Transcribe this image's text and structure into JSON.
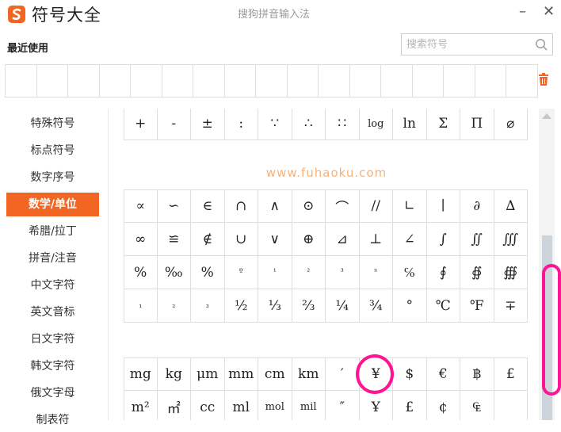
{
  "window": {
    "title": "符号大全",
    "ime_name": "搜狗拼音输入法",
    "minimize": "–",
    "close": "✕"
  },
  "recent": {
    "label": "最近使用",
    "slots": 17
  },
  "search": {
    "placeholder": "搜索符号",
    "value": ""
  },
  "categories": [
    "特殊符号",
    "标点符号",
    "数字序号",
    "数学/单位",
    "希腊/拉丁",
    "拼音/注音",
    "中文字符",
    "英文音标",
    "日文字符",
    "韩文字符",
    "俄文字母",
    "制表符"
  ],
  "active_category": "数学/单位",
  "symbols": {
    "row_partial": [
      "+",
      "-",
      "±",
      ":",
      "∵",
      "∴",
      "∷",
      "log",
      "ln",
      "Σ",
      "Π",
      "⌀"
    ],
    "watermark": "www.fuhaoku.com",
    "block_a": [
      "∝",
      "∽",
      "∈",
      "∩",
      "∧",
      "⊙",
      "⌒",
      "//",
      "∟",
      "∣",
      "∂",
      "∆",
      "∞",
      "≌",
      "∉",
      "∪",
      "∨",
      "⊕",
      "⊿",
      "⊥",
      "∠",
      "∫",
      "∬",
      "∭",
      "%",
      "‰",
      "%",
      "º",
      "¹",
      "²",
      "³",
      "ⁿ",
      "℅",
      "∮",
      "∯",
      "∰",
      "₁",
      "₂",
      "₃",
      "½",
      "⅓",
      "⅔",
      "¼",
      "¾",
      "°",
      "℃",
      "℉",
      "∓"
    ],
    "block_b": [
      "mg",
      "kg",
      "μm",
      "mm",
      "cm",
      "km",
      "′",
      "¥",
      "$",
      "€",
      "฿",
      "£",
      "m²",
      "㎡",
      "cc",
      "ml",
      "mol",
      "mil",
      "″",
      "Ұ",
      "£",
      "¢",
      "₠",
      ""
    ]
  },
  "colors": {
    "accent": "#f26522",
    "highlight": "#ff1493",
    "watermark": "#f6b27a"
  }
}
